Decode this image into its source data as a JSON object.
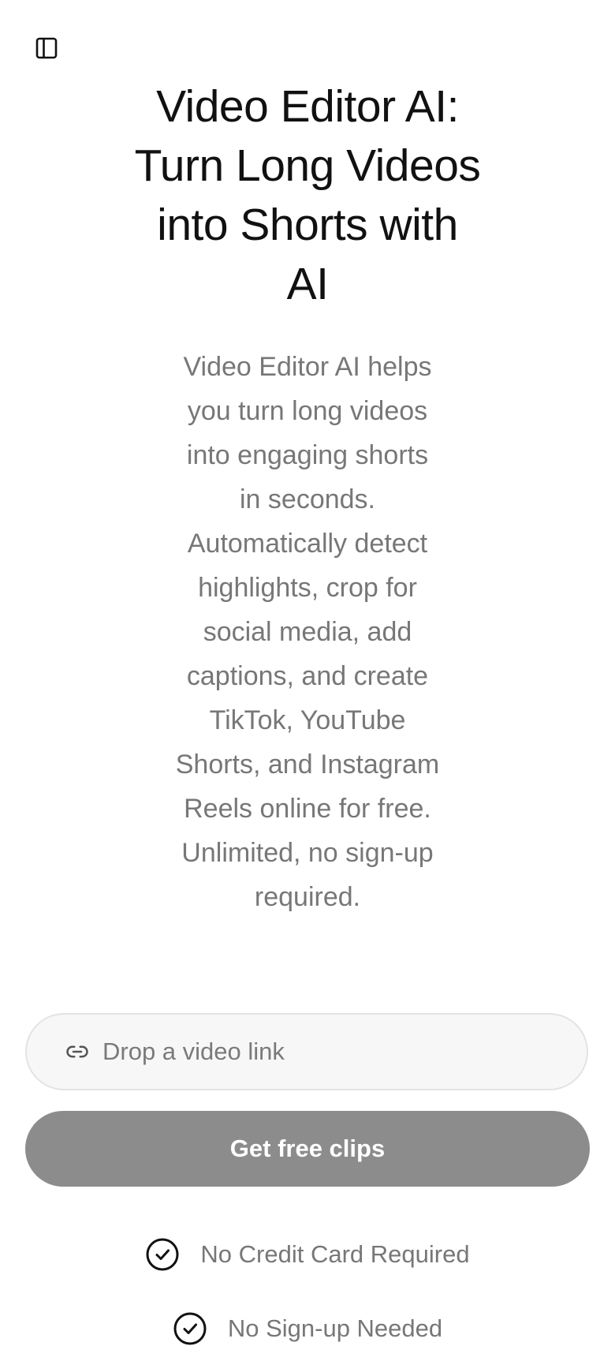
{
  "header": {
    "sidebar_toggle_icon": "sidebar-panel-icon"
  },
  "hero": {
    "title": "Video Editor AI: Turn Long Videos into Shorts with AI",
    "description": "Video Editor AI helps you turn long videos into engaging shorts in seconds. Automatically detect highlights, crop for social media, add captions, and create TikTok, YouTube Shorts, and Instagram Reels online for free. Unlimited, no sign-up required."
  },
  "link_input": {
    "placeholder": "Drop a video link",
    "value": "",
    "icon": "link-icon"
  },
  "cta": {
    "label": "Get free clips",
    "background": "#8c8c8c"
  },
  "benefits": [
    {
      "label": "No Credit Card Required",
      "icon": "check-circle-icon"
    },
    {
      "label": "No Sign-up Needed",
      "icon": "check-circle-icon"
    }
  ]
}
